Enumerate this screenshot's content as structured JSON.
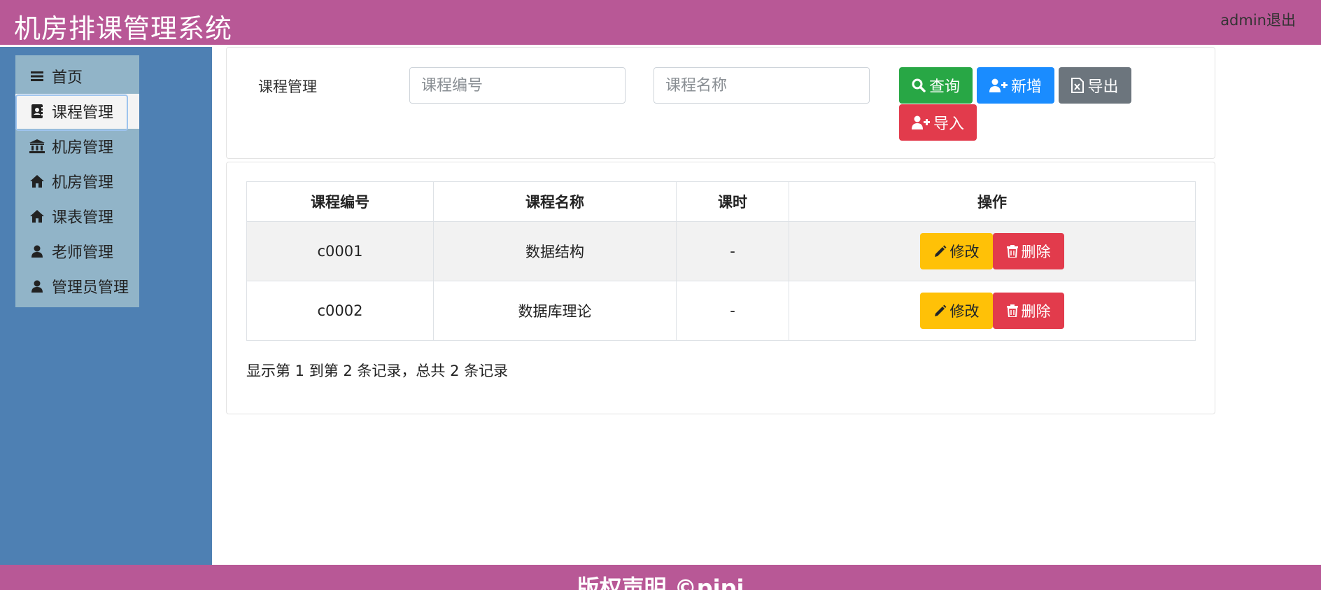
{
  "header": {
    "title": "机房排课管理系统",
    "user": "admin",
    "logout": "退出"
  },
  "sidebar": {
    "items": [
      {
        "label": "首页",
        "icon": "menu-bars-icon"
      },
      {
        "label": "课程管理",
        "icon": "contact-book-icon",
        "active": true
      },
      {
        "label": "机房管理",
        "icon": "bank-building-icon"
      },
      {
        "label": "机房管理",
        "icon": "home-icon"
      },
      {
        "label": "课表管理",
        "icon": "home-icon"
      },
      {
        "label": "老师管理",
        "icon": "user-icon"
      },
      {
        "label": "管理员管理",
        "icon": "user-icon"
      }
    ]
  },
  "search": {
    "label": "课程管理",
    "code_placeholder": "课程编号",
    "name_placeholder": "课程名称",
    "search_button": "查询",
    "add_button": "新增",
    "export_button": "导出",
    "import_button": "导入"
  },
  "table": {
    "columns": [
      "课程编号",
      "课程名称",
      "课时",
      "操作"
    ],
    "rows": [
      {
        "code": "c0001",
        "name": "数据结构",
        "hours": "-"
      },
      {
        "code": "c0002",
        "name": "数据库理论",
        "hours": "-"
      }
    ],
    "edit_label": "修改",
    "delete_label": "删除",
    "record_info": "显示第 1 到第 2 条记录，总共 2 条记录"
  },
  "footer": {
    "text": "版权声明 ©pipi"
  },
  "colors": {
    "header": "#b85896",
    "sidebar": "#4e80b3",
    "menu": "#91b4c8",
    "search": "#28a745",
    "add": "#1a8cff",
    "export": "#6c757d",
    "danger": "#e23b4c",
    "warning": "#ffc107"
  }
}
